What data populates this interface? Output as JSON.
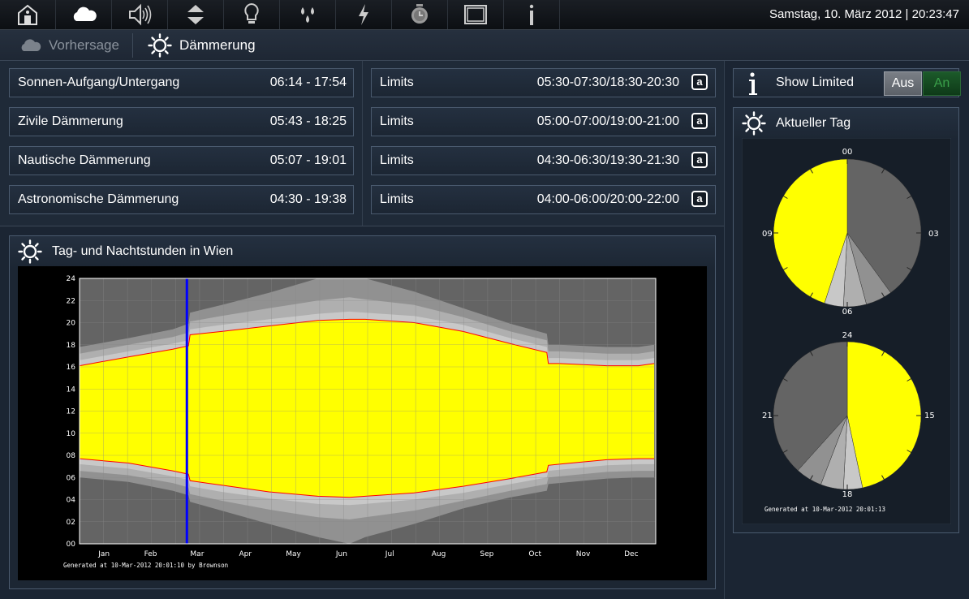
{
  "topbar": {
    "datetime": "Samstag, 10. März 2012 | 20:23:47",
    "icons": [
      "home-icon",
      "cloud-icon",
      "speaker-icon",
      "up-down-arrows-icon",
      "bulb-icon",
      "drops-icon",
      "lightning-icon",
      "alarm-clock-icon",
      "window-icon",
      "info-icon"
    ]
  },
  "tabs": {
    "forecast": "Vorhersage",
    "twilight": "Dämmerung"
  },
  "twilight": [
    {
      "label": "Sonnen-Aufgang/Untergang",
      "value": "06:14 - 17:54"
    },
    {
      "label": "Zivile Dämmerung",
      "value": "05:43 - 18:25"
    },
    {
      "label": "Nautische Dämmerung",
      "value": "05:07 - 19:01"
    },
    {
      "label": "Astronomische Dämmerung",
      "value": "04:30 - 19:38"
    }
  ],
  "limits": [
    {
      "label": "Limits",
      "value": "05:30-07:30/18:30-20:30",
      "btn": "a"
    },
    {
      "label": "Limits",
      "value": "05:00-07:00/19:00-21:00",
      "btn": "a"
    },
    {
      "label": "Limits",
      "value": "04:30-06:30/19:30-21:30",
      "btn": "a"
    },
    {
      "label": "Limits",
      "value": "04:00-06:00/20:00-22:00",
      "btn": "a"
    }
  ],
  "show_limited": {
    "label": "Show Limited",
    "off": "Aus",
    "on": "An"
  },
  "current_day": {
    "title": "Aktueller Tag",
    "top_labels": {
      "top": "00",
      "right": "03",
      "bottom": "06",
      "left": "09"
    },
    "bottom_labels": {
      "top": "24",
      "right": "15",
      "bottom": "18",
      "left": "21"
    },
    "generated": "Generated at 10-Mar-2012 20:01:13"
  },
  "colors": {
    "day": "#ffff00",
    "night": "#646464",
    "civil": "#c8c8c8",
    "nautical": "#afafaf",
    "astro": "#919191",
    "marker": "#0000ff",
    "sunline": "#ff0000"
  },
  "chart_data": {
    "type": "area",
    "title": "Tag- und Nachtstunden in Wien",
    "months": [
      "Jan",
      "Feb",
      "Mar",
      "Apr",
      "May",
      "Jun",
      "Jul",
      "Aug",
      "Sep",
      "Oct",
      "Nov",
      "Dec"
    ],
    "x": [
      1,
      32,
      60,
      70,
      71,
      91,
      121,
      152,
      172,
      182,
      213,
      244,
      274,
      297,
      298,
      305,
      335,
      355,
      365
    ],
    "sunrise": [
      7.7,
      7.3,
      6.6,
      6.3,
      5.7,
      5.3,
      4.7,
      4.3,
      4.2,
      4.3,
      4.6,
      5.2,
      5.9,
      6.5,
      7.1,
      7.2,
      7.6,
      7.7,
      7.7
    ],
    "sunset": [
      16.1,
      16.9,
      17.6,
      17.9,
      18.9,
      19.2,
      19.7,
      20.2,
      20.3,
      20.3,
      20.0,
      19.2,
      18.1,
      17.3,
      16.3,
      16.3,
      16.1,
      16.1,
      16.3
    ],
    "civil_dawn": [
      7.2,
      6.8,
      6.1,
      5.8,
      5.2,
      4.7,
      4.1,
      3.6,
      3.5,
      3.6,
      4.0,
      4.6,
      5.4,
      6.0,
      6.6,
      6.7,
      7.1,
      7.2,
      7.2
    ],
    "civil_dusk": [
      16.6,
      17.4,
      18.1,
      18.4,
      19.4,
      19.8,
      20.3,
      20.8,
      21.0,
      20.9,
      20.6,
      19.8,
      18.6,
      17.8,
      16.8,
      16.8,
      16.6,
      16.6,
      16.8
    ],
    "nautical_dawn": [
      6.6,
      6.2,
      5.5,
      5.1,
      4.5,
      3.9,
      3.1,
      2.4,
      2.2,
      2.4,
      3.0,
      3.9,
      4.8,
      5.4,
      6.0,
      6.1,
      6.5,
      6.6,
      6.6
    ],
    "nautical_dusk": [
      17.2,
      18.0,
      18.7,
      19.1,
      20.1,
      20.6,
      21.3,
      22.0,
      22.3,
      22.1,
      21.6,
      20.5,
      19.2,
      18.4,
      17.4,
      17.4,
      17.2,
      17.2,
      17.4
    ],
    "astro_dawn": [
      6.0,
      5.6,
      4.8,
      4.4,
      3.8,
      3.0,
      1.8,
      0.6,
      0.0,
      0.6,
      1.8,
      3.2,
      4.2,
      4.8,
      5.4,
      5.5,
      5.9,
      6.0,
      6.0
    ],
    "astro_dusk": [
      17.8,
      18.6,
      19.4,
      19.9,
      20.9,
      21.6,
      22.7,
      24.0,
      24.0,
      24.0,
      22.8,
      21.3,
      19.9,
      19.0,
      18.0,
      18.0,
      17.8,
      17.8,
      18.0
    ],
    "current_day": 69,
    "ylim": [
      0,
      24
    ],
    "xlim": [
      1,
      366
    ],
    "yticks": [
      "00",
      "02",
      "04",
      "06",
      "08",
      "10",
      "12",
      "14",
      "16",
      "18",
      "20",
      "22",
      "24"
    ],
    "grid": true,
    "footer": "Generated at 10-Mar-2012 20:01:10 by Brownson"
  }
}
